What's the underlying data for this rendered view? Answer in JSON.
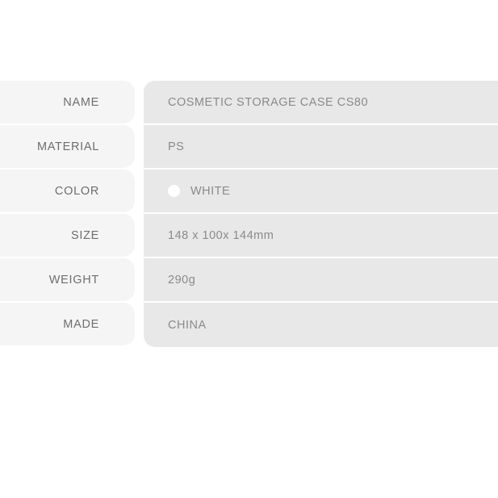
{
  "spec_table": {
    "colors": {
      "page_background": "#ffffff",
      "label_cell_background": "#f5f5f5",
      "value_cell_background": "#e8e8e8",
      "label_text": "#6e6e6e",
      "value_text": "#8a8a8a"
    },
    "rows": [
      {
        "label": "NAME",
        "value": "COSMETIC STORAGE CASE CS80",
        "swatch": null
      },
      {
        "label": "MATERIAL",
        "value": "PS",
        "swatch": null
      },
      {
        "label": "COLOR",
        "value": "WHITE",
        "swatch": "#ffffff"
      },
      {
        "label": "SIZE",
        "value": "148 x 100x 144mm",
        "swatch": null
      },
      {
        "label": "WEIGHT",
        "value": "290g",
        "swatch": null
      },
      {
        "label": "MADE",
        "value": "CHINA",
        "swatch": null
      }
    ]
  }
}
